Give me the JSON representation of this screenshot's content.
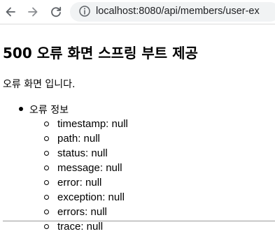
{
  "browser": {
    "url": "localhost:8080/api/members/user-ex"
  },
  "page": {
    "title": "500 오류 화면 스프링 부트 제공",
    "description": "오류 화면 입니다.",
    "section_label": "오류 정보",
    "fields": [
      "timestamp: null",
      "path: null",
      "status: null",
      "message: null",
      "error: null",
      "exception: null",
      "errors: null",
      "trace: null"
    ]
  }
}
